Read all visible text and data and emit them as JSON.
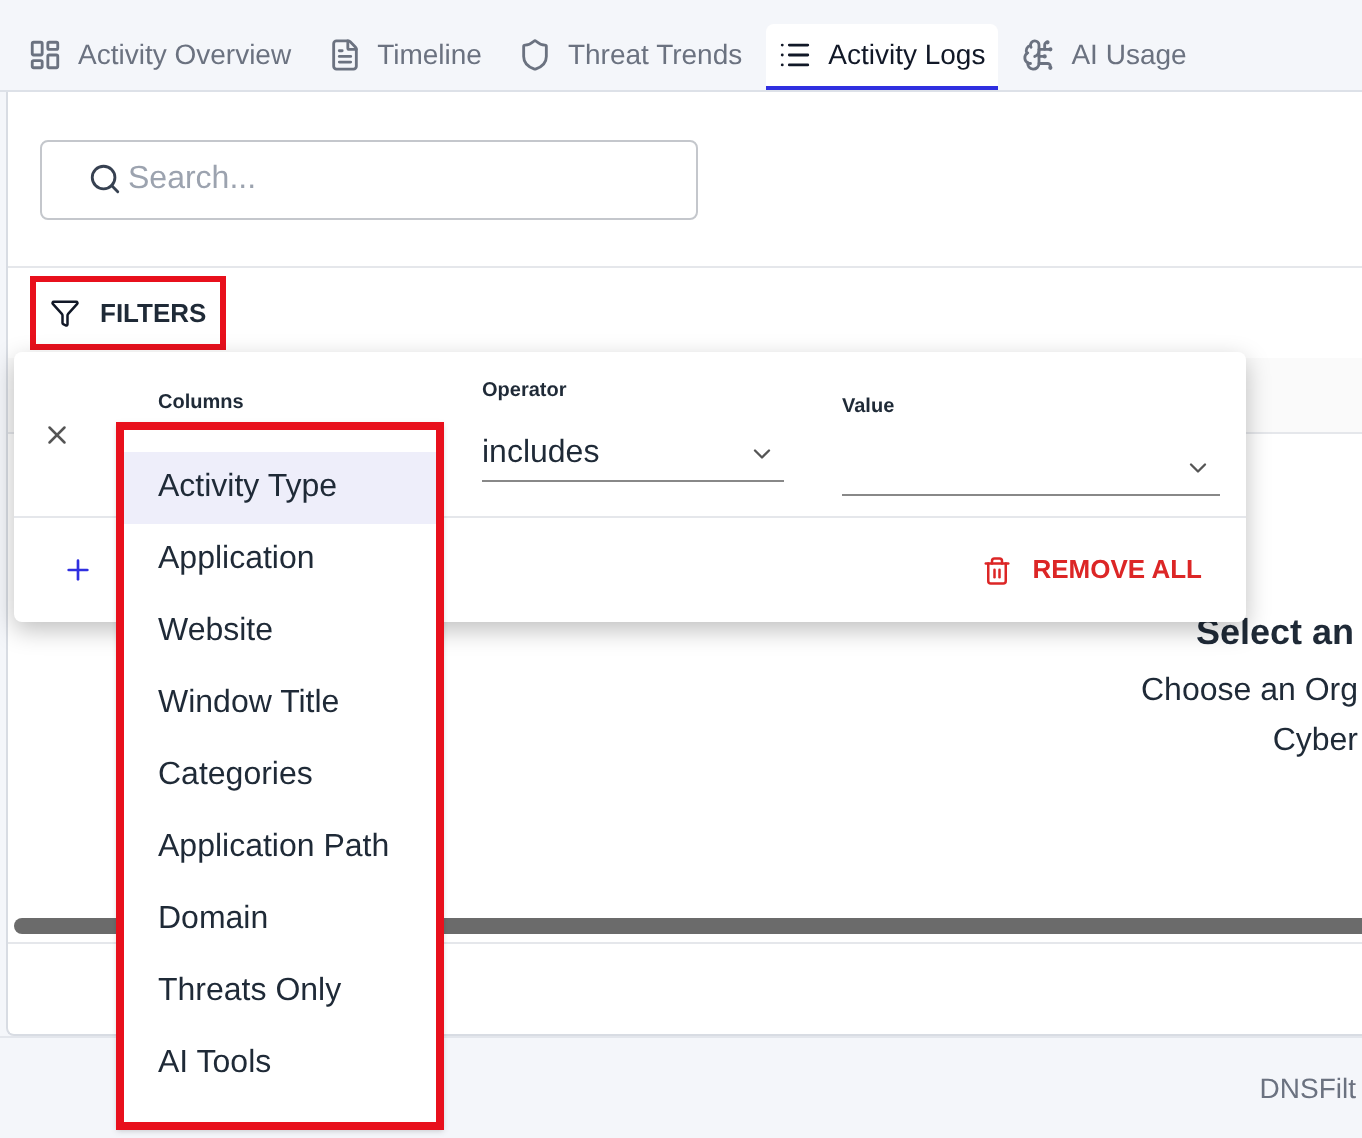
{
  "tabs": [
    {
      "label": "Activity Overview",
      "selected": false
    },
    {
      "label": "Timeline",
      "selected": false
    },
    {
      "label": "Threat Trends",
      "selected": false
    },
    {
      "label": "Activity Logs",
      "selected": true
    },
    {
      "label": "AI Usage",
      "selected": false
    }
  ],
  "search": {
    "placeholder": "Search..."
  },
  "filters_button": {
    "label": "FILTERS"
  },
  "filter_panel": {
    "columns_label": "Columns",
    "operator_label": "Operator",
    "operator_value": "includes",
    "value_label": "Value",
    "remove_all": "REMOVE ALL"
  },
  "column_menu": [
    {
      "label": "Activity Type",
      "selected": true
    },
    {
      "label": "Application",
      "selected": false
    },
    {
      "label": "Website",
      "selected": false
    },
    {
      "label": "Window Title",
      "selected": false
    },
    {
      "label": "Categories",
      "selected": false
    },
    {
      "label": "Application Path",
      "selected": false
    },
    {
      "label": "Domain",
      "selected": false
    },
    {
      "label": "Threats Only",
      "selected": false
    },
    {
      "label": "AI Tools",
      "selected": false
    }
  ],
  "empty_state": {
    "title": "Select an",
    "lines": [
      "Choose an Org",
      "Cyber"
    ]
  },
  "footer": {
    "text": "DNSFilt"
  }
}
